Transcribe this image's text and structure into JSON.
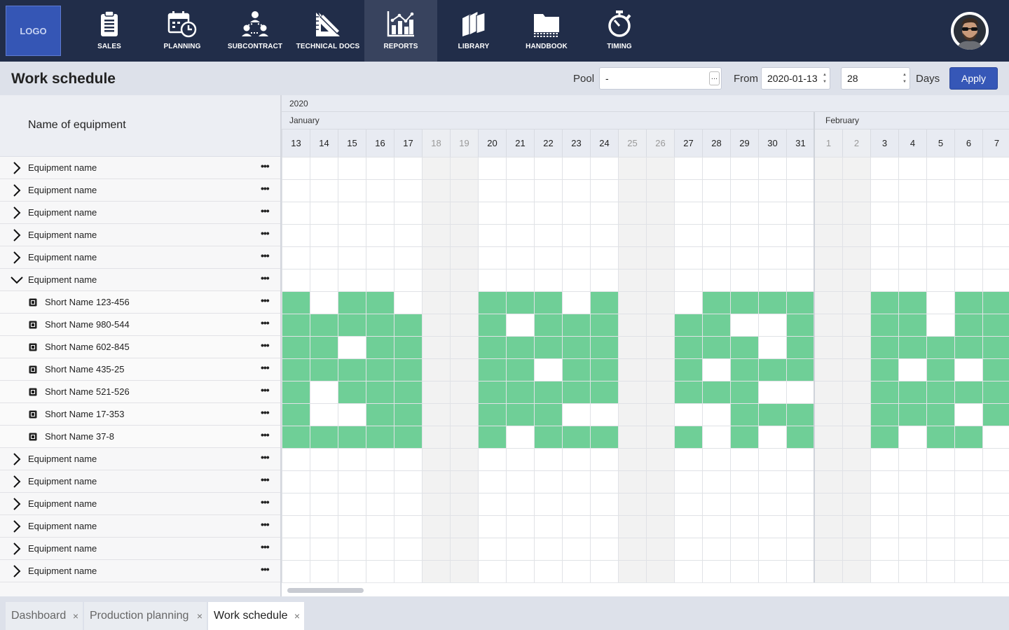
{
  "logo": {
    "text": "LOGO"
  },
  "nav": [
    {
      "label": "SALES",
      "icon": "clipboard-icon"
    },
    {
      "label": "PLANNING",
      "icon": "calendar-clock-icon"
    },
    {
      "label": "SUBCONTRACT",
      "icon": "network-icon"
    },
    {
      "label": "TECHNICAL DOCS",
      "icon": "drafting-triangle-icon"
    },
    {
      "label": "REPORTS",
      "icon": "bar-chart-icon",
      "active": true
    },
    {
      "label": "LIBRARY",
      "icon": "books-icon"
    },
    {
      "label": "HANDBOOK",
      "icon": "folder-icon"
    },
    {
      "label": "TIMING",
      "icon": "stopwatch-icon"
    }
  ],
  "header": {
    "title": "Work schedule",
    "pool_label": "Pool",
    "pool_value": "-",
    "pool_more": "...",
    "from_label": "From",
    "from_value": "2020-01-13",
    "days_value": "28",
    "days_label": "Days",
    "apply_label": "Apply"
  },
  "left": {
    "column_header": "Name of equipment",
    "more_glyph": "•••",
    "rows": [
      {
        "type": "group",
        "name": "Equipment name",
        "expanded": false
      },
      {
        "type": "group",
        "name": "Equipment name",
        "expanded": false
      },
      {
        "type": "group",
        "name": "Equipment name",
        "expanded": false
      },
      {
        "type": "group",
        "name": "Equipment name",
        "expanded": false
      },
      {
        "type": "group",
        "name": "Equipment name",
        "expanded": false
      },
      {
        "type": "group",
        "name": "Equipment name",
        "expanded": true
      },
      {
        "type": "child",
        "name": "Short Name 123-456"
      },
      {
        "type": "child",
        "name": "Short Name 980-544"
      },
      {
        "type": "child",
        "name": "Short Name 602-845"
      },
      {
        "type": "child",
        "name": "Short Name 435-25"
      },
      {
        "type": "child",
        "name": "Short Name 521-526"
      },
      {
        "type": "child",
        "name": "Short Name 17-353"
      },
      {
        "type": "child",
        "name": "Short Name 37-8"
      },
      {
        "type": "group",
        "name": "Equipment name",
        "expanded": false
      },
      {
        "type": "group",
        "name": "Equipment name",
        "expanded": false
      },
      {
        "type": "group",
        "name": "Equipment name",
        "expanded": false
      },
      {
        "type": "group",
        "name": "Equipment name",
        "expanded": false
      },
      {
        "type": "group",
        "name": "Equipment name",
        "expanded": false
      },
      {
        "type": "group",
        "name": "Equipment name",
        "expanded": false
      }
    ]
  },
  "calendar": {
    "year": "2020",
    "months": [
      {
        "name": "January",
        "start_index": 0
      },
      {
        "name": "February",
        "start_index": 19
      }
    ],
    "days": [
      {
        "d": "13",
        "weekend": false
      },
      {
        "d": "14",
        "weekend": false
      },
      {
        "d": "15",
        "weekend": false
      },
      {
        "d": "16",
        "weekend": false
      },
      {
        "d": "17",
        "weekend": false
      },
      {
        "d": "18",
        "weekend": true
      },
      {
        "d": "19",
        "weekend": true
      },
      {
        "d": "20",
        "weekend": false
      },
      {
        "d": "21",
        "weekend": false
      },
      {
        "d": "22",
        "weekend": false
      },
      {
        "d": "23",
        "weekend": false
      },
      {
        "d": "24",
        "weekend": false
      },
      {
        "d": "25",
        "weekend": true
      },
      {
        "d": "26",
        "weekend": true
      },
      {
        "d": "27",
        "weekend": false
      },
      {
        "d": "28",
        "weekend": false
      },
      {
        "d": "29",
        "weekend": false
      },
      {
        "d": "30",
        "weekend": false
      },
      {
        "d": "31",
        "weekend": false
      },
      {
        "d": "1",
        "weekend": true
      },
      {
        "d": "2",
        "weekend": true
      },
      {
        "d": "3",
        "weekend": false
      },
      {
        "d": "4",
        "weekend": false
      },
      {
        "d": "5",
        "weekend": false
      },
      {
        "d": "6",
        "weekend": false
      },
      {
        "d": "7",
        "weekend": false
      }
    ],
    "booked_color": "#6fcf97",
    "weekend_color": "#f2f2f2",
    "booked": [
      [
        1,
        0,
        1,
        1,
        0,
        0,
        0,
        1,
        1,
        1,
        0,
        1,
        0,
        0,
        0,
        1,
        1,
        1,
        1,
        0,
        0,
        1,
        1,
        0,
        1,
        1
      ],
      [
        1,
        1,
        1,
        1,
        1,
        0,
        0,
        1,
        0,
        1,
        1,
        1,
        0,
        0,
        1,
        1,
        0,
        0,
        1,
        0,
        0,
        1,
        1,
        0,
        1,
        1
      ],
      [
        1,
        1,
        0,
        1,
        1,
        0,
        0,
        1,
        1,
        1,
        1,
        1,
        0,
        0,
        1,
        1,
        1,
        0,
        1,
        0,
        0,
        1,
        1,
        1,
        1,
        1
      ],
      [
        1,
        1,
        1,
        1,
        1,
        0,
        0,
        1,
        1,
        0,
        1,
        1,
        0,
        0,
        1,
        0,
        1,
        1,
        1,
        0,
        0,
        1,
        0,
        1,
        0,
        1
      ],
      [
        1,
        0,
        1,
        1,
        1,
        0,
        0,
        1,
        1,
        1,
        1,
        1,
        0,
        0,
        1,
        1,
        1,
        0,
        0,
        0,
        0,
        1,
        1,
        1,
        1,
        1
      ],
      [
        1,
        0,
        0,
        1,
        1,
        0,
        0,
        1,
        1,
        1,
        0,
        0,
        0,
        0,
        0,
        0,
        1,
        1,
        1,
        0,
        0,
        1,
        1,
        1,
        0,
        1
      ],
      [
        1,
        1,
        1,
        1,
        1,
        0,
        0,
        1,
        0,
        1,
        1,
        1,
        0,
        0,
        1,
        0,
        1,
        0,
        1,
        0,
        0,
        1,
        0,
        1,
        1,
        0
      ]
    ]
  },
  "tabs": [
    {
      "label": "Dashboard",
      "active": false
    },
    {
      "label": "Production planning",
      "active": false
    },
    {
      "label": "Work schedule",
      "active": true
    }
  ],
  "close_glyph": "×"
}
